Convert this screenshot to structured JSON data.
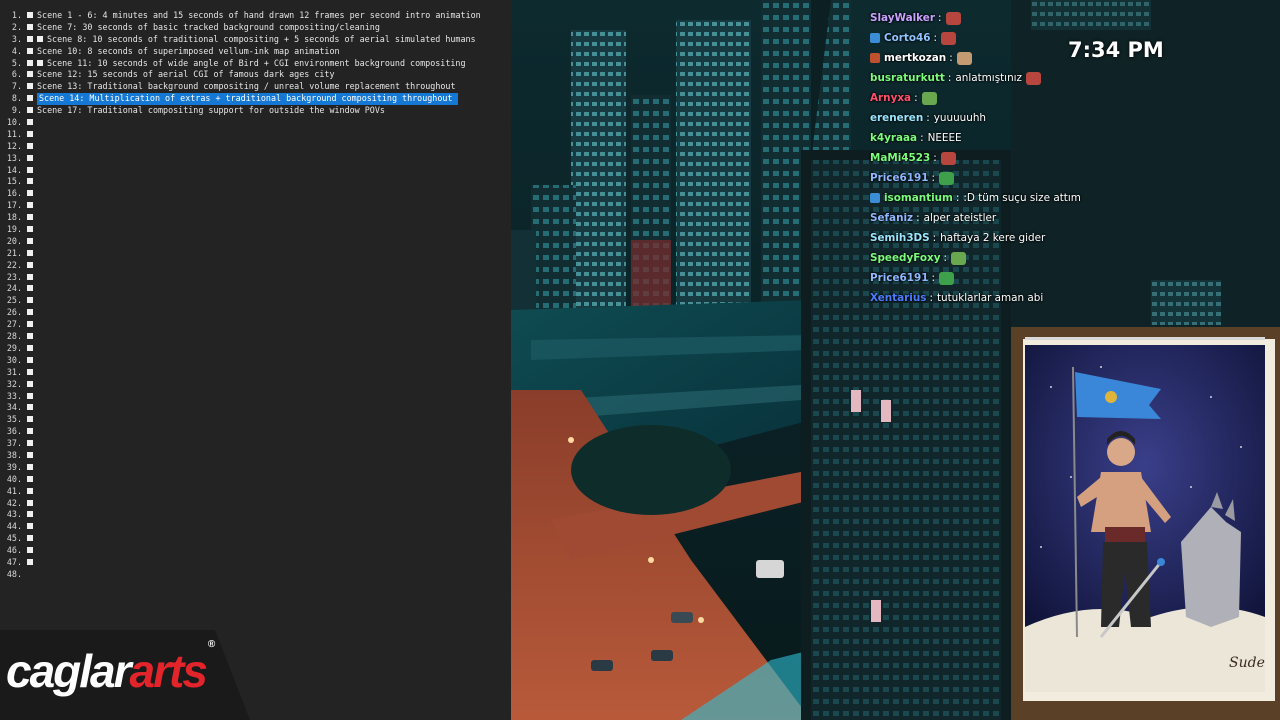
{
  "editor": {
    "lines": [
      {
        "n": "1.",
        "text": "Scene 1 - 6: 4 minutes and 15 seconds of hand drawn 12 frames per second intro animation",
        "markers": 1,
        "selected": false,
        "prop": true
      },
      {
        "n": "2.",
        "text": "Scene 7: 30 seconds of basic tracked background compositing/cleaning",
        "markers": 1,
        "selected": false
      },
      {
        "n": "3.",
        "text": "Scene 8: 10 seconds of traditional compositing + 5 seconds of aerial simulated humans",
        "markers": 2,
        "selected": false
      },
      {
        "n": "4.",
        "text": "Scene 10: 8 seconds of superimposed vellum-ink map animation",
        "markers": 1,
        "selected": false
      },
      {
        "n": "5.",
        "text": "Scene 11: 10 seconds of wide angle of Bird + CGI environment background compositing",
        "markers": 2,
        "selected": false
      },
      {
        "n": "6.",
        "text": "Scene 12: 15 seconds of aerial CGI of famous dark ages city",
        "markers": 1,
        "selected": false
      },
      {
        "n": "7.",
        "text": "Scene 13: Traditional background compositing / unreal volume replacement throughout",
        "markers": 1,
        "selected": false
      },
      {
        "n": "8.",
        "text": "Scene 14: Multiplication of extras + traditional background compositing throughout",
        "markers": 1,
        "selected": true
      },
      {
        "n": "9.",
        "text": "Scene 17: Traditional compositing support for outside the window POVs",
        "markers": 1,
        "selected": false
      },
      {
        "n": "10.",
        "text": "",
        "markers": 1
      },
      {
        "n": "11.",
        "text": "",
        "markers": 1
      },
      {
        "n": "12.",
        "text": "",
        "markers": 1
      },
      {
        "n": "13.",
        "text": "",
        "markers": 1
      },
      {
        "n": "14.",
        "text": "",
        "markers": 1
      },
      {
        "n": "15.",
        "text": "",
        "markers": 1
      },
      {
        "n": "16.",
        "text": "",
        "markers": 1
      },
      {
        "n": "17.",
        "text": "",
        "markers": 1
      },
      {
        "n": "18.",
        "text": "",
        "markers": 1
      },
      {
        "n": "19.",
        "text": "",
        "markers": 1
      },
      {
        "n": "20.",
        "text": "",
        "markers": 1
      },
      {
        "n": "21.",
        "text": "",
        "markers": 1
      },
      {
        "n": "22.",
        "text": "",
        "markers": 1
      },
      {
        "n": "23.",
        "text": "",
        "markers": 1
      },
      {
        "n": "24.",
        "text": "",
        "markers": 1
      },
      {
        "n": "25.",
        "text": "",
        "markers": 1
      },
      {
        "n": "26.",
        "text": "",
        "markers": 1
      },
      {
        "n": "27.",
        "text": "",
        "markers": 1
      },
      {
        "n": "28.",
        "text": "",
        "markers": 1
      },
      {
        "n": "29.",
        "text": "",
        "markers": 1
      },
      {
        "n": "30.",
        "text": "",
        "markers": 1
      },
      {
        "n": "31.",
        "text": "",
        "markers": 1
      },
      {
        "n": "32.",
        "text": "",
        "markers": 1
      },
      {
        "n": "33.",
        "text": "",
        "markers": 1
      },
      {
        "n": "34.",
        "text": "",
        "markers": 1
      },
      {
        "n": "35.",
        "text": "",
        "markers": 1
      },
      {
        "n": "36.",
        "text": "",
        "markers": 1
      },
      {
        "n": "37.",
        "text": "",
        "markers": 1
      },
      {
        "n": "38.",
        "text": "",
        "markers": 1
      },
      {
        "n": "39.",
        "text": "",
        "markers": 1
      },
      {
        "n": "40.",
        "text": "",
        "markers": 1
      },
      {
        "n": "41.",
        "text": "",
        "markers": 1
      },
      {
        "n": "42.",
        "text": "",
        "markers": 1
      },
      {
        "n": "43.",
        "text": "",
        "markers": 1
      },
      {
        "n": "44.",
        "text": "",
        "markers": 1
      },
      {
        "n": "45.",
        "text": "",
        "markers": 1
      },
      {
        "n": "46.",
        "text": "",
        "markers": 1
      },
      {
        "n": "47.",
        "text": "",
        "markers": 1
      },
      {
        "n": "48.",
        "text": "",
        "markers": 0
      }
    ]
  },
  "logo": {
    "part1": "caglar",
    "part2": "arts",
    "mark": "®"
  },
  "clock": {
    "time": "7:34 PM"
  },
  "chat": {
    "messages": [
      {
        "user": "SlayWalker",
        "color": "#c9a2ff",
        "text": "",
        "emote": "#b7463e",
        "badge": ""
      },
      {
        "user": "Corto46",
        "color": "#8fc4ff",
        "text": "",
        "emote": "#b7463e",
        "badge": "#3b8ed6"
      },
      {
        "user": "mertkozan",
        "color": "#ffffff",
        "text": "",
        "emote": "#c49a72",
        "badge": "#c0512e"
      },
      {
        "user": "busraturkutt",
        "color": "#7bfc7b",
        "text": "anlatmıştınız",
        "emote": "#b7463e",
        "badge": ""
      },
      {
        "user": "Arnyxa",
        "color": "#ff4f6a",
        "text": "",
        "emote": "#6aa84f",
        "badge": ""
      },
      {
        "user": "ereneren",
        "color": "#9be6ff",
        "text": "yuuuuuhh",
        "emote": "",
        "badge": ""
      },
      {
        "user": "k4yraaa",
        "color": "#7bfc7b",
        "text": "NEEEE",
        "emote": "",
        "badge": ""
      },
      {
        "user": "MaMi4523",
        "color": "#7bfc7b",
        "text": "",
        "emote": "#b7463e",
        "badge": ""
      },
      {
        "user": "Price6191",
        "color": "#8fb8ff",
        "text": "",
        "emote": "#3fa04b",
        "badge": ""
      },
      {
        "user": "isomantium",
        "color": "#7bfc7b",
        "text": ":D tüm suçu size attım",
        "emote": "",
        "badge": "#3b8ed6"
      },
      {
        "user": "Sefaniz",
        "color": "#8fb8ff",
        "text": "alper ateistler",
        "emote": "",
        "badge": ""
      },
      {
        "user": "Semih3DS",
        "color": "#9be6ff",
        "text": "haftaya 2 kere gider",
        "emote": "",
        "badge": ""
      },
      {
        "user": "SpeedyFoxy",
        "color": "#7bfc7b",
        "text": "",
        "emote": "#6aa84f",
        "badge": ""
      },
      {
        "user": "Price6191",
        "color": "#8fb8ff",
        "text": "",
        "emote": "#3fa04b",
        "badge": ""
      },
      {
        "user": "Xentarius",
        "color": "#4d7dff",
        "text": "tutuklarlar aman abi",
        "emote": "",
        "badge": ""
      }
    ]
  },
  "painting": {
    "signature": "Sude"
  }
}
